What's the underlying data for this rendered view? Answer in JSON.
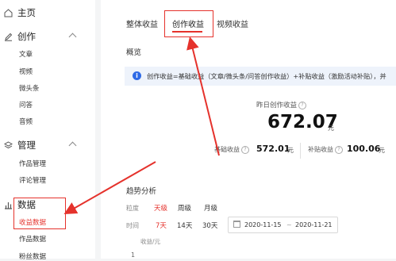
{
  "sidebar": {
    "home": "主页",
    "create": {
      "label": "创作",
      "items": [
        "文章",
        "视频",
        "微头条",
        "问答",
        "音频"
      ]
    },
    "manage": {
      "label": "管理",
      "items": [
        "作品管理",
        "评论管理"
      ]
    },
    "data": {
      "label": "数据",
      "items": [
        "收益数据",
        "作品数据",
        "粉丝数据"
      ]
    }
  },
  "tabs": [
    "整体收益",
    "创作收益",
    "视频收益"
  ],
  "overview_title": "概览",
  "notice": "创作收益=基础收益（文章/微头条/问答创作收益）+补贴收益（激励活动补贴），并",
  "yesterday": {
    "label": "昨日创作收益",
    "value": "672.07",
    "unit": "元"
  },
  "base": {
    "label": "基础收益",
    "value": "572.01",
    "unit": "元"
  },
  "subsidy": {
    "label": "补贴收益",
    "value": "100.06",
    "unit": "元"
  },
  "trend": {
    "title": "趋势分析",
    "granularity": {
      "label": "粒度",
      "options": [
        "天级",
        "周级",
        "月级"
      ]
    },
    "time": {
      "label": "时间",
      "options": [
        "7天",
        "14天",
        "30天"
      ]
    },
    "date_start": "2020-11-15",
    "date_sep": "~",
    "date_end": "2020-11-21",
    "axis_label": "收益/元",
    "axis_tick": "1"
  },
  "colors": {
    "accent": "#e5322c",
    "info": "#2e6ae6"
  }
}
